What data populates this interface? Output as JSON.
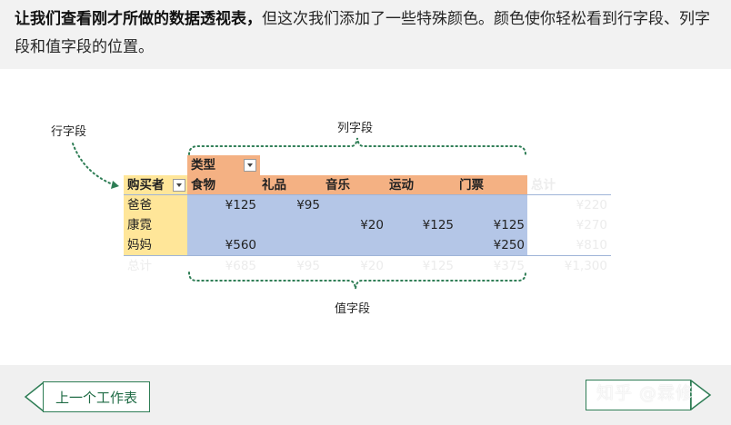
{
  "header": {
    "bold_text": "让我们查看刚才所做的数据透视表，",
    "text": "但这次我们添加了一些特殊颜色。颜色使你轻松看到行字段、列字段和值字段的位置。"
  },
  "annotations": {
    "row_field": "行字段",
    "column_field": "列字段",
    "value_field": "值字段"
  },
  "colors": {
    "row_area": "#ffe699",
    "column_area": "#f4b183",
    "value_area": "#b4c6e7",
    "accent": "#2e7d55"
  },
  "pivot": {
    "column_header_caption": "类型",
    "row_header_caption": "购买者",
    "columns": [
      "食物",
      "礼品",
      "音乐",
      "运动",
      "门票"
    ],
    "total_label": "总计",
    "rows": [
      {
        "name": "爸爸",
        "values": [
          "¥125",
          "¥95",
          "",
          "",
          ""
        ],
        "total": "¥220"
      },
      {
        "name": "康霓",
        "values": [
          "",
          "",
          "¥20",
          "¥125",
          "¥125"
        ],
        "total": "¥270"
      },
      {
        "name": "妈妈",
        "values": [
          "¥560",
          "",
          "",
          "",
          "¥250"
        ],
        "total": "¥810"
      }
    ],
    "grand_totals": [
      "¥685",
      "¥95",
      "¥20",
      "¥125",
      "¥375"
    ],
    "grand_total": "¥1,300"
  },
  "footer": {
    "prev_button": "上一个工作表",
    "watermark": "知乎 @霖修",
    "next_button_icon": "arrow-right-icon"
  }
}
